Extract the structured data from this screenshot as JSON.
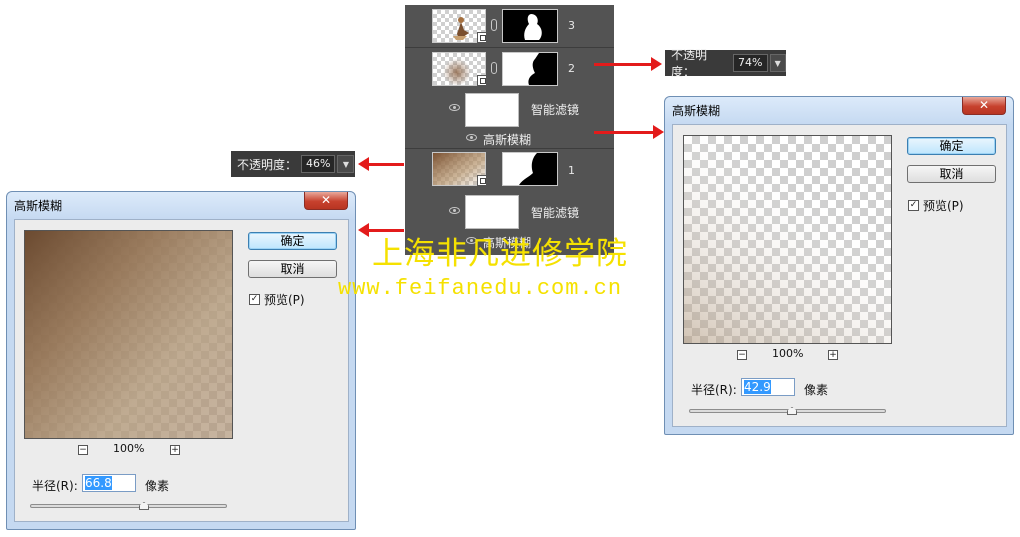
{
  "layers_panel": {
    "layers": [
      {
        "number": "3"
      },
      {
        "number": "2"
      },
      {
        "number": "1"
      }
    ],
    "smart_filters_label": "智能滤镜",
    "gaussian_blur_label": "高斯模糊"
  },
  "opacity_badges": {
    "label": "不透明度：",
    "layer2_value": "74%",
    "layer1_value": "46%"
  },
  "dialog_left": {
    "title": "高斯模糊",
    "ok_label": "确定",
    "cancel_label": "取消",
    "preview_label": "预览(P)",
    "preview_checked": true,
    "zoom_level": "100%",
    "radius_label": "半径(R):",
    "radius_value": "66.8",
    "unit_label": "像素",
    "slider_fraction": 0.58
  },
  "dialog_right": {
    "title": "高斯模糊",
    "ok_label": "确定",
    "cancel_label": "取消",
    "preview_label": "预览(P)",
    "preview_checked": true,
    "zoom_level": "100%",
    "radius_label": "半径(R):",
    "radius_value": "42.9",
    "unit_label": "像素",
    "slider_fraction": 0.52
  },
  "watermark": {
    "line1": "上海非凡进修学院",
    "line2": "www.feifanedu.com.cn"
  },
  "colors": {
    "arrow": "#e31b1b",
    "watermark": "#f5e100",
    "panel": "#535353"
  },
  "icons": {
    "close": "close-icon",
    "eye": "eye-icon",
    "chain": "chain-link-icon",
    "smart_object": "smart-object-icon",
    "zoom_out": "minus-icon",
    "zoom_in": "plus-icon"
  }
}
